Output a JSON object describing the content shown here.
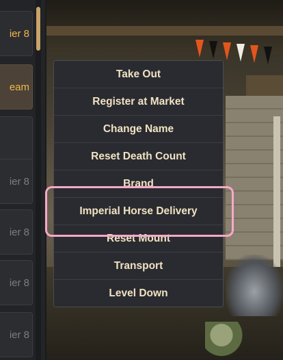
{
  "horse_list": {
    "slots": [
      {
        "label": "ier 8",
        "state": "normal",
        "highlight": true
      },
      {
        "label": "eam",
        "state": "selected",
        "highlight": true
      },
      {
        "label": "",
        "state": "normal",
        "highlight": false
      },
      {
        "label": "ier 8",
        "state": "normal",
        "highlight": false
      },
      {
        "label": "ier 8",
        "state": "normal",
        "highlight": false
      },
      {
        "label": "ier 8",
        "state": "normal",
        "highlight": false
      },
      {
        "label": "ier 8",
        "state": "normal",
        "highlight": false
      }
    ]
  },
  "context_menu": {
    "items": [
      "Take Out",
      "Register at Market",
      "Change Name",
      "Reset Death Count",
      "Brand",
      "Imperial Horse Delivery",
      "Reset Mount",
      "Transport",
      "Level Down"
    ],
    "highlighted_item": "Imperial Horse Delivery"
  },
  "colors": {
    "menu_text": "#f0e2c3",
    "gold_text": "#f2b84a",
    "highlight_outline": "#f6a9c9"
  }
}
